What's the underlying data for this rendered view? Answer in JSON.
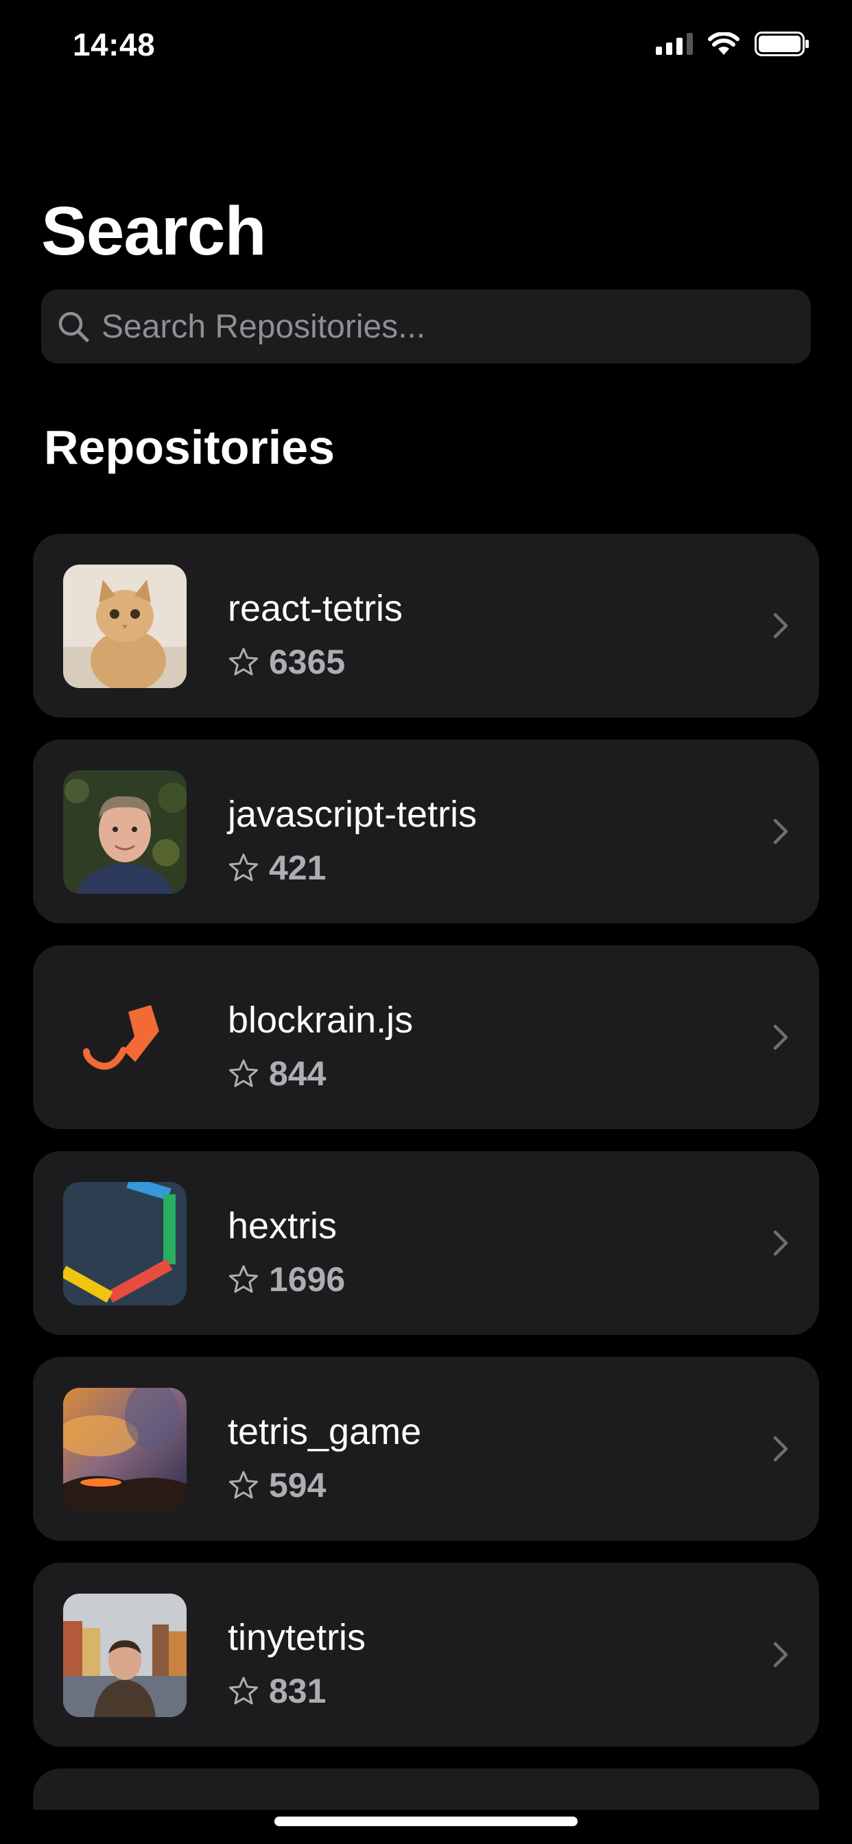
{
  "status_bar": {
    "time": "14:48"
  },
  "header": {
    "title": "Search"
  },
  "search": {
    "placeholder": "Search Repositories..."
  },
  "section": {
    "title": "Repositories"
  },
  "repositories": [
    {
      "name": "react-tetris",
      "stars": "6365",
      "avatar": "cat-photo-avatar"
    },
    {
      "name": "javascript-tetris",
      "stars": "421",
      "avatar": "man-portrait-avatar"
    },
    {
      "name": "blockrain.js",
      "stars": "844",
      "avatar": "orange-logo-avatar"
    },
    {
      "name": "hextris",
      "stars": "1696",
      "avatar": "hexagon-logo-avatar"
    },
    {
      "name": "tetris_game",
      "stars": "594",
      "avatar": "sunset-landscape-avatar"
    },
    {
      "name": "tinytetris",
      "stars": "831",
      "avatar": "man-harbor-avatar"
    }
  ],
  "colors": {
    "background": "#000000",
    "card": "#1c1c1e",
    "secondary_text": "#aeaeb2",
    "placeholder": "#8e8e93"
  }
}
